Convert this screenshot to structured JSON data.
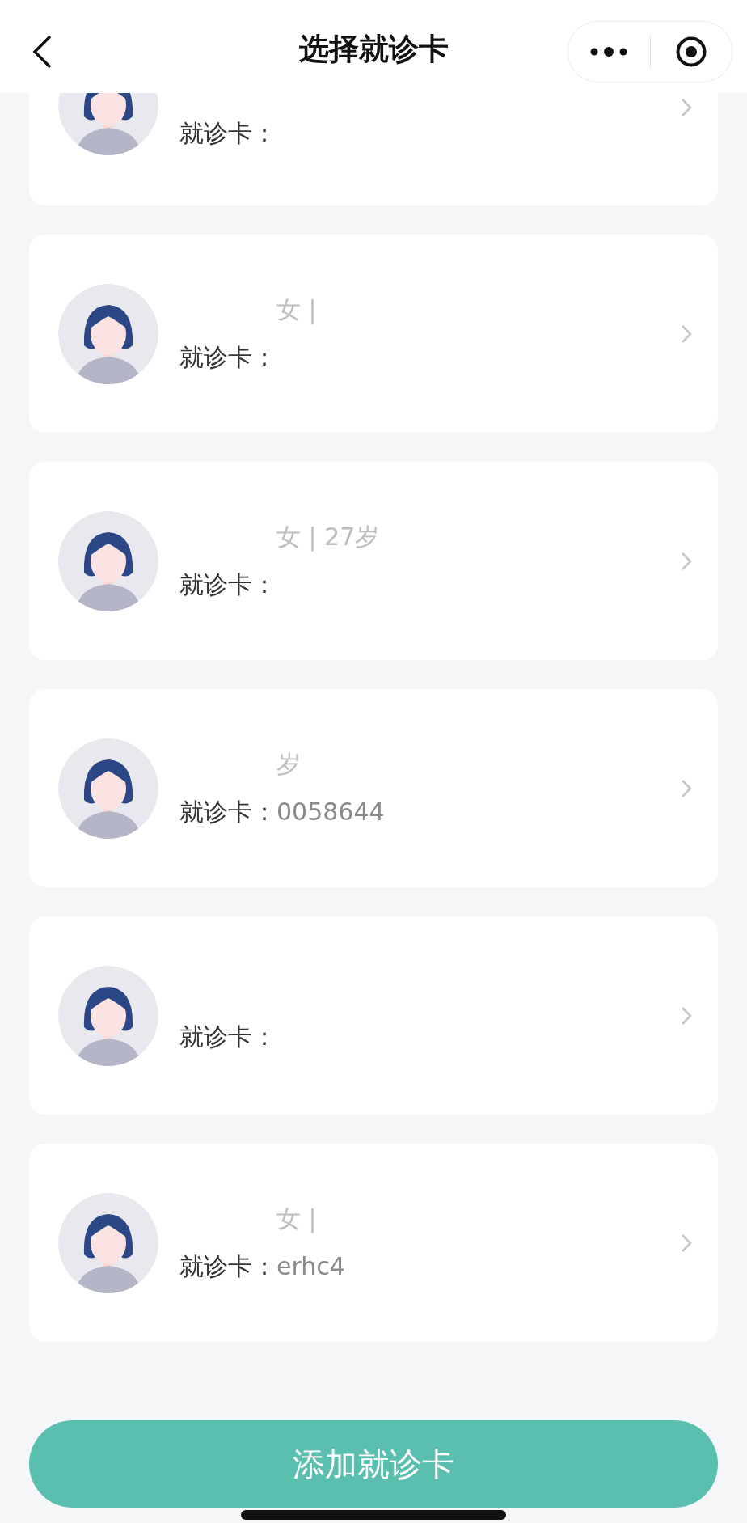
{
  "header": {
    "title": "选择就诊卡"
  },
  "cards": [
    {
      "card_label": "就诊卡："
    },
    {
      "info": "女 |",
      "card_label": "就诊卡："
    },
    {
      "info": "女 | 27岁",
      "card_label": "就诊卡："
    },
    {
      "info": "岁",
      "card_label": "就诊卡：",
      "card_number": "0058644"
    },
    {
      "card_label": "就诊卡："
    },
    {
      "info": "女 |",
      "card_label": "就诊卡：",
      "card_number": "erhc4"
    }
  ],
  "add_button": {
    "label": "添加就诊卡"
  }
}
